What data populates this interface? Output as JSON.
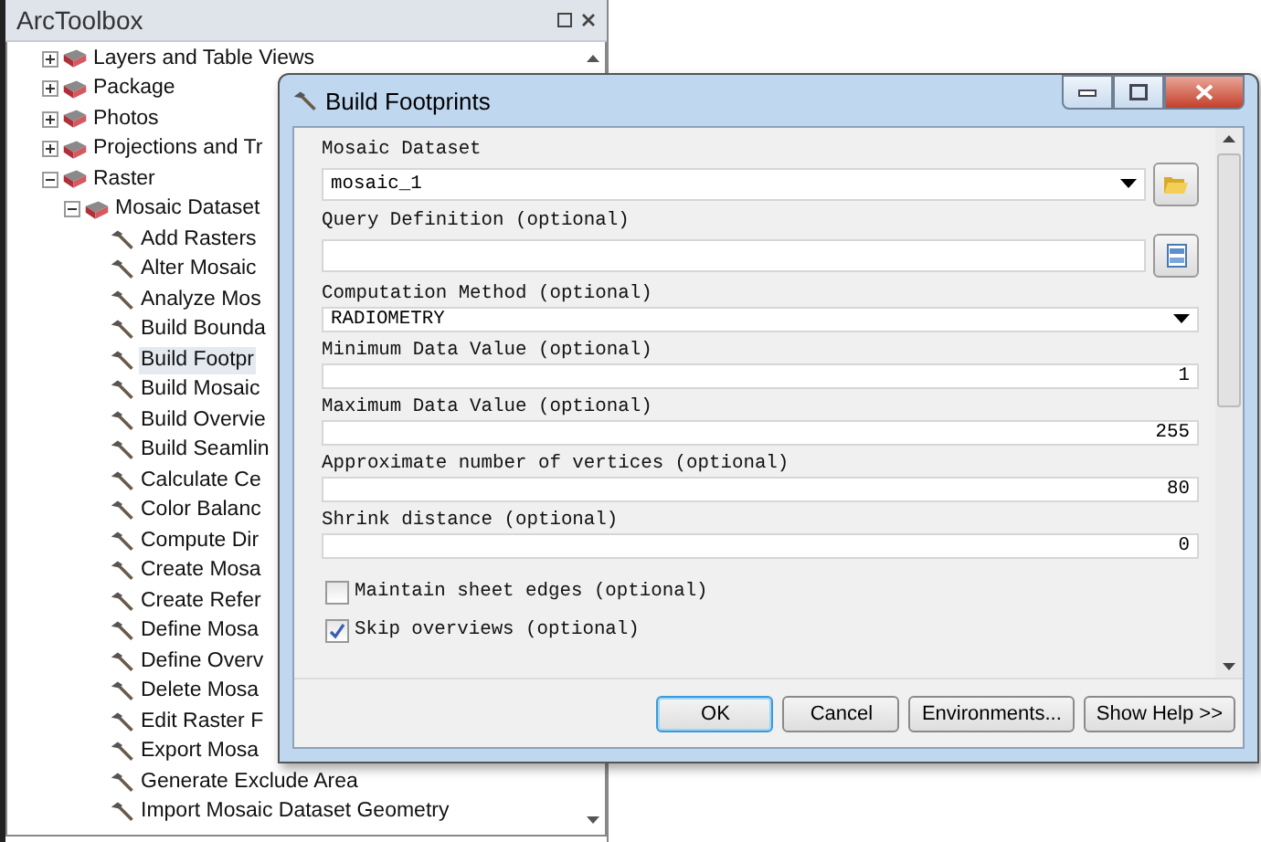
{
  "toolbox": {
    "title": "ArcToolbox",
    "tree": [
      {
        "label": "Layers and Table Views",
        "kind": "toolset",
        "expanded": false
      },
      {
        "label": "Package",
        "kind": "toolset",
        "expanded": false
      },
      {
        "label": "Photos",
        "kind": "toolset",
        "expanded": false
      },
      {
        "label": "Projections and Tr",
        "kind": "toolset",
        "expanded": false
      },
      {
        "label": "Raster",
        "kind": "toolset",
        "expanded": true,
        "children": [
          {
            "label": "Mosaic Dataset",
            "kind": "toolset",
            "expanded": true,
            "children": [
              {
                "label": "Add Rasters",
                "kind": "tool",
                "selected": false
              },
              {
                "label": "Alter Mosaic",
                "kind": "tool",
                "selected": false
              },
              {
                "label": "Analyze Mos",
                "kind": "tool",
                "selected": false
              },
              {
                "label": "Build Bounda",
                "kind": "tool",
                "selected": false
              },
              {
                "label": "Build Footpr",
                "kind": "tool",
                "selected": true
              },
              {
                "label": "Build Mosaic",
                "kind": "tool",
                "selected": false
              },
              {
                "label": "Build Overvie",
                "kind": "tool",
                "selected": false
              },
              {
                "label": "Build Seamlin",
                "kind": "tool",
                "selected": false
              },
              {
                "label": "Calculate Ce",
                "kind": "tool",
                "selected": false
              },
              {
                "label": "Color Balanc",
                "kind": "tool",
                "selected": false
              },
              {
                "label": "Compute Dir",
                "kind": "tool",
                "selected": false
              },
              {
                "label": "Create Mosa",
                "kind": "tool",
                "selected": false
              },
              {
                "label": "Create Refer",
                "kind": "tool",
                "selected": false
              },
              {
                "label": "Define Mosa",
                "kind": "tool",
                "selected": false
              },
              {
                "label": "Define Overv",
                "kind": "tool",
                "selected": false
              },
              {
                "label": "Delete Mosa",
                "kind": "tool",
                "selected": false
              },
              {
                "label": "Edit Raster F",
                "kind": "tool",
                "selected": false
              },
              {
                "label": "Export Mosa",
                "kind": "tool",
                "selected": false
              },
              {
                "label": "Generate Exclude Area",
                "kind": "tool",
                "selected": false
              },
              {
                "label": "Import Mosaic Dataset Geometry",
                "kind": "tool",
                "selected": false
              }
            ]
          }
        ]
      }
    ]
  },
  "dialog": {
    "title": "Build Footprints",
    "parameters": [
      {
        "kind": "combo",
        "label": "Mosaic Dataset",
        "value": "mosaic_1"
      },
      {
        "kind": "query",
        "label": "Query Definition (optional)"
      },
      {
        "kind": "dropdown",
        "label": "Computation Method (optional)",
        "value": "RADIOMETRY"
      },
      {
        "kind": "number",
        "label": "Minimum Data Value (optional)",
        "value": "1"
      },
      {
        "kind": "number",
        "label": "Maximum Data Value (optional)",
        "value": "255"
      },
      {
        "kind": "number",
        "label": "Approximate number of vertices (optional)",
        "value": "80"
      },
      {
        "kind": "number",
        "label": "Shrink distance (optional)",
        "value": "0"
      },
      {
        "kind": "checkbox",
        "label": "Maintain sheet edges (optional)",
        "checked": false
      },
      {
        "kind": "checkbox",
        "label": "Skip overviews (optional)",
        "checked": true
      }
    ],
    "buttons": [
      {
        "label": "OK",
        "default": true
      },
      {
        "label": "Cancel",
        "default": false
      },
      {
        "label": "Environments...",
        "default": false
      },
      {
        "label": "Show Help >>",
        "default": false
      }
    ]
  }
}
